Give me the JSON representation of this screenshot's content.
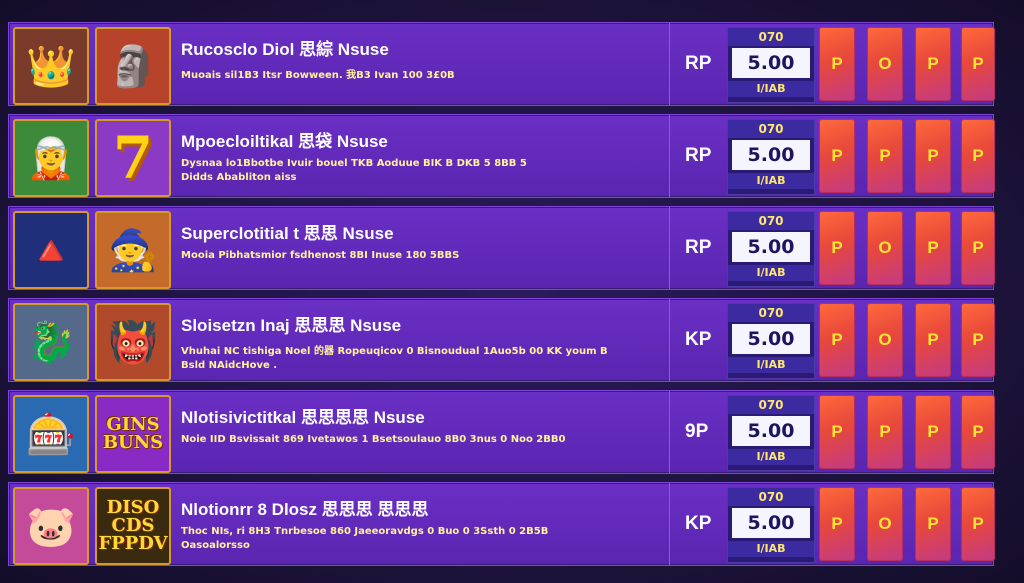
{
  "rows": [
    {
      "title": "Rucosclo Diol 思綜 Nsuse",
      "line1": "Muoais sil1B3 Itsr Bowween. 我B3 Ivan 100 3£0B",
      "line2": "",
      "thumb_a": {
        "icon": "king-icon",
        "glyph": "👑",
        "bg": "#7a3b2a"
      },
      "thumb_b": {
        "icon": "warrior-icon",
        "glyph": "🗿",
        "bg": "#b7432a"
      },
      "currency": "RP",
      "odds_top": "070",
      "odds_value": "5.00",
      "odds_bottom": "I/IAB",
      "buttons": [
        "P",
        "O",
        "P",
        "P"
      ]
    },
    {
      "title": "Mpoecloiltikal 思袋 Nsuse",
      "line1": "Dysnaa lo1Bbotbe Ivuir bouel TKB Aoduue BIK B DKB 5 8BB 5",
      "line2": "Didds Ababliton aiss",
      "thumb_a": {
        "icon": "warrior-icon",
        "glyph": "🧝",
        "bg": "#3d8a3a"
      },
      "thumb_b": {
        "icon": "seven-icon",
        "glyph": "7",
        "bg": "#8a3ac4"
      },
      "currency": "RP",
      "odds_top": "070",
      "odds_value": "5.00",
      "odds_bottom": "I/IAB",
      "buttons": [
        "P",
        "P",
        "P",
        "P"
      ]
    },
    {
      "title": "Superclotitial t 思思 Nsuse",
      "line1": "Mooia Pibhatsmior fsdhenost 8BI Inuse 180 5BBS",
      "line2": "",
      "thumb_a": {
        "icon": "gem-icon",
        "glyph": "🔺",
        "bg": "#1f2f7a"
      },
      "thumb_b": {
        "icon": "warrior-icon",
        "glyph": "🧙",
        "bg": "#c46a2a"
      },
      "currency": "RP",
      "odds_top": "070",
      "odds_value": "5.00",
      "odds_bottom": "I/IAB",
      "buttons": [
        "P",
        "O",
        "P",
        "P"
      ]
    },
    {
      "title": "Sloisetzn Inaj 思思思 Nsuse",
      "line1": "Vhuhai NC tishiga Noel 的器 Ropeuqicov 0 Bisnoudual 1Auo5b 00 KK youm B",
      "line2": "Bsld NAidcHove .",
      "thumb_a": {
        "icon": "dragon-icon",
        "glyph": "🐉",
        "bg": "#556a8a"
      },
      "thumb_b": {
        "icon": "warrior-icon",
        "glyph": "👹",
        "bg": "#b04a2a"
      },
      "currency": "KP",
      "odds_top": "070",
      "odds_value": "5.00",
      "odds_bottom": "I/IAB",
      "buttons": [
        "P",
        "O",
        "P",
        "P"
      ]
    },
    {
      "title": "Nlotisivictitkal 思思思思 Nsuse",
      "line1": "Noie IID Bsvissait 869 Ivetawos 1 Bsetsoulauo 8B0 3nus 0 Noo 2BB0",
      "line2": "",
      "thumb_a": {
        "icon": "slot-reel-icon",
        "glyph": "🎰",
        "bg": "#2a6ab0"
      },
      "thumb_b": {
        "icon": "gems-icon",
        "glyph": "GINS BUNS",
        "bg": "#8a2ac4"
      },
      "currency": "9P",
      "odds_top": "070",
      "odds_value": "5.00",
      "odds_bottom": "I/IAB",
      "buttons": [
        "P",
        "P",
        "P",
        "P"
      ]
    },
    {
      "title": "Nlotionrr 8 Dlosz 思思思 思思思",
      "line1": "Thoc NIs, ri 8H3 Tnrbesoe 860 Jaeeoravdgs 0 Buo 0 3Ssth 0 2B5B",
      "line2": "Oasoalorsso",
      "thumb_a": {
        "icon": "pig-icon",
        "glyph": "🐷",
        "bg": "#c44a9a"
      },
      "thumb_b": {
        "icon": "gold-icon",
        "glyph": "DISO CDS FPPDV",
        "bg": "#3a2a10"
      },
      "currency": "KP",
      "odds_top": "070",
      "odds_value": "5.00",
      "odds_bottom": "I/IAB",
      "buttons": [
        "P",
        "O",
        "P",
        "P"
      ]
    }
  ]
}
